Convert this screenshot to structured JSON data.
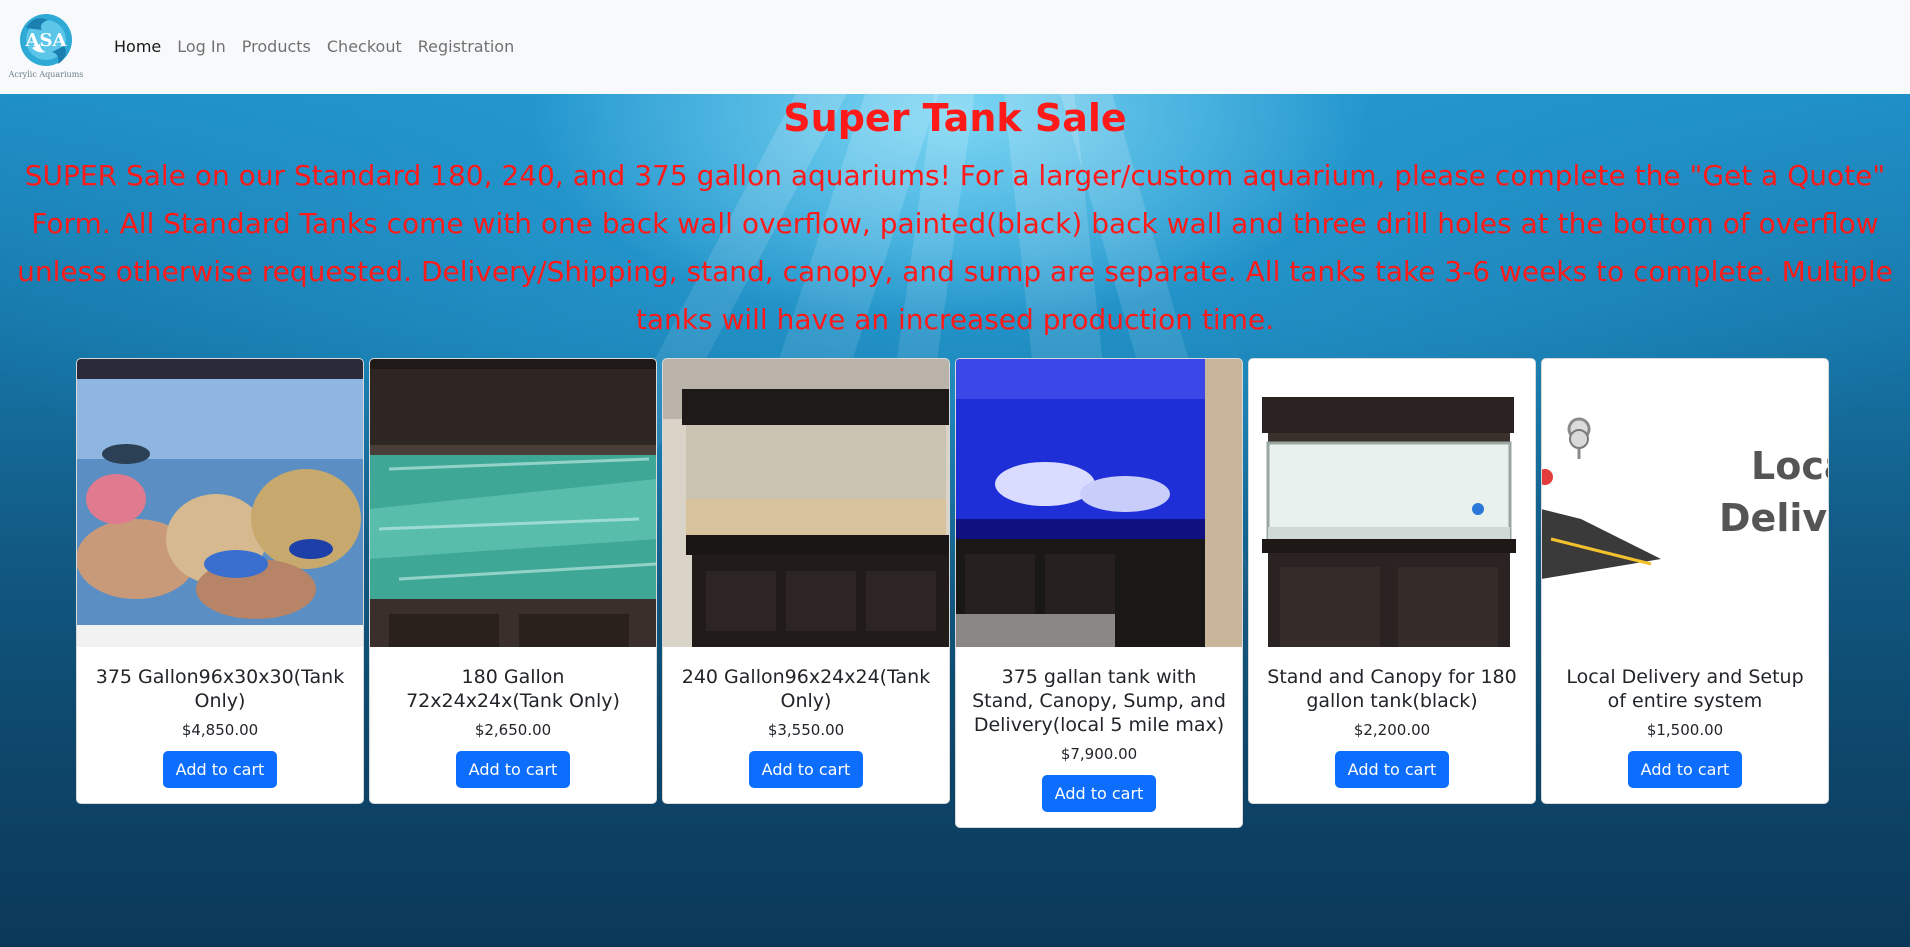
{
  "brand": {
    "logo_caption": "Acrylic Aquariums"
  },
  "nav": [
    {
      "label": "Home",
      "active": true
    },
    {
      "label": "Log In",
      "active": false
    },
    {
      "label": "Products",
      "active": false
    },
    {
      "label": "Checkout",
      "active": false
    },
    {
      "label": "Registration",
      "active": false
    }
  ],
  "hero": {
    "title": "Super Tank Sale",
    "text": "SUPER Sale on our Standard 180, 240, and 375 gallon aquariums! For a larger/custom aquarium, please complete the \"Get a Quote\" Form. All Standard Tanks come with one back wall overflow, painted(black) back wall and three drill holes at the bottom of overflow unless otherwise requested. Delivery/Shipping, stand, canopy, and sump are separate. All tanks take 3-6 weeks to complete. Multiple tanks will have an increased production time."
  },
  "products": [
    {
      "title": "375 Gallon96x30x30(Tank Only)",
      "price": "$4,850.00",
      "button": "Add to cart",
      "image": "reef-aquarium-photo"
    },
    {
      "title": "180 Gallon 72x24x24x(Tank Only)",
      "price": "$2,650.00",
      "button": "Add to cart",
      "image": "empty-tank-photo"
    },
    {
      "title": "240 Gallon96x24x24(Tank Only)",
      "price": "$3,550.00",
      "button": "Add to cart",
      "image": "tank-on-stand-photo"
    },
    {
      "title": "375 gallan tank with Stand, Canopy, Sump, and Delivery(local 5 mile max)",
      "price": "$7,900.00",
      "button": "Add to cart",
      "image": "blue-lit-tank-photo"
    },
    {
      "title": "Stand and Canopy for 180 gallon tank(black)",
      "price": "$2,200.00",
      "button": "Add to cart",
      "image": "stand-canopy-photo"
    },
    {
      "title": "Local Delivery and Setup of entire system",
      "price": "$1,500.00",
      "button": "Add to cart",
      "image": "local-delivery-graphic",
      "image_text": [
        "Loca",
        "Delive"
      ]
    }
  ],
  "colors": {
    "sale_text": "#ff1a1a",
    "button": "#0d6efd",
    "navbar": "#f8f9fa"
  }
}
